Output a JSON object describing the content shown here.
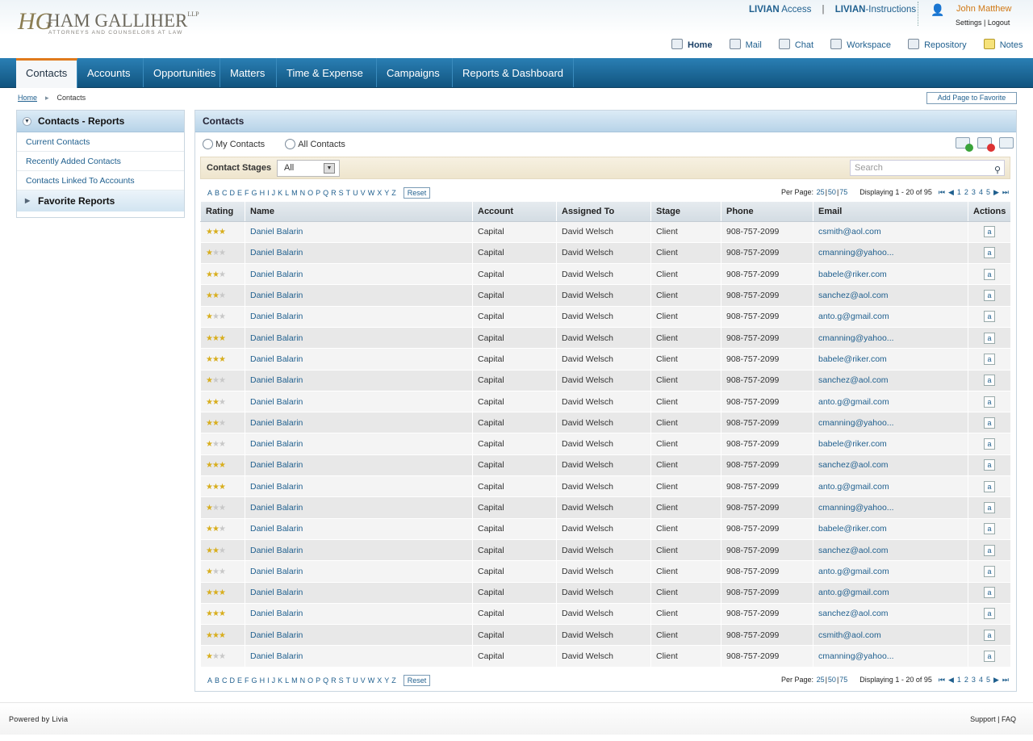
{
  "brand": {
    "monogram": "HG",
    "firm": "HAM GALLIHER",
    "llp": "LLP",
    "tagline": "ATTORNEYS AND COUNSELORS AT LAW"
  },
  "toplinks": {
    "livian": "LIVIAN",
    "access": "Access",
    "sep": "|",
    "instructions": "-Instructions"
  },
  "user": {
    "name": "John Matthew",
    "settings": "Settings",
    "sep": "|",
    "logout": "Logout"
  },
  "iconnav": [
    "Home",
    "Mail",
    "Chat",
    "Workspace",
    "Repository",
    "Notes"
  ],
  "tabs": [
    "Contacts",
    "Accounts",
    "Opportunities",
    "Matters",
    "Time & Expense",
    "Campaigns",
    "Reports & Dashboard"
  ],
  "crumbs": {
    "home": "Home",
    "current": "Contacts"
  },
  "fav_button": "Add Page to Favorite",
  "side": {
    "title": "Contacts - Reports",
    "items": [
      "Current Contacts",
      "Recently Added Contacts",
      "Contacts Linked To Accounts"
    ],
    "favorites": "Favorite Reports"
  },
  "panel": {
    "title": "Contacts",
    "radio_my": "My Contacts",
    "radio_all": "All Contacts",
    "stage_label": "Contact Stages",
    "stage_value": "All",
    "search_placeholder": "Search"
  },
  "pager": {
    "letters": [
      "A",
      "B",
      "C",
      "D",
      "E",
      "F",
      "G",
      "H",
      "I",
      "J",
      "K",
      "L",
      "M",
      "N",
      "O",
      "P",
      "Q",
      "R",
      "S",
      "T",
      "U",
      "V",
      "W",
      "X",
      "Y",
      "Z"
    ],
    "reset": "Reset",
    "per_page_label": "Per Page:",
    "per_25": "25",
    "per_50": "50",
    "per_75": "75",
    "displaying": "Displaying 1 - 20 of 95",
    "pages": [
      "1",
      "2",
      "3",
      "4",
      "5"
    ]
  },
  "columns": [
    "Rating",
    "Name",
    "Account",
    "Assigned To",
    "Stage",
    "Phone",
    "Email",
    "Actions"
  ],
  "rows": [
    {
      "rating": 3,
      "name": "Daniel Balarin",
      "account": "Capital",
      "assigned": "David Welsch",
      "stage": "Client",
      "phone": "908-757-2099",
      "email": "csmith@aol.com"
    },
    {
      "rating": 1,
      "name": "Daniel Balarin",
      "account": "Capital",
      "assigned": "David Welsch",
      "stage": "Client",
      "phone": "908-757-2099",
      "email": "cmanning@yahoo..."
    },
    {
      "rating": 2,
      "name": "Daniel Balarin",
      "account": "Capital",
      "assigned": "David Welsch",
      "stage": "Client",
      "phone": "908-757-2099",
      "email": "babele@riker.com"
    },
    {
      "rating": 2,
      "name": "Daniel Balarin",
      "account": "Capital",
      "assigned": "David Welsch",
      "stage": "Client",
      "phone": "908-757-2099",
      "email": "sanchez@aol.com"
    },
    {
      "rating": 1,
      "name": "Daniel Balarin",
      "account": "Capital",
      "assigned": "David Welsch",
      "stage": "Client",
      "phone": "908-757-2099",
      "email": "anto.g@gmail.com"
    },
    {
      "rating": 3,
      "name": "Daniel Balarin",
      "account": "Capital",
      "assigned": "David Welsch",
      "stage": "Client",
      "phone": "908-757-2099",
      "email": "cmanning@yahoo..."
    },
    {
      "rating": 3,
      "name": "Daniel Balarin",
      "account": "Capital",
      "assigned": "David Welsch",
      "stage": "Client",
      "phone": "908-757-2099",
      "email": "babele@riker.com"
    },
    {
      "rating": 1,
      "name": "Daniel Balarin",
      "account": "Capital",
      "assigned": "David Welsch",
      "stage": "Client",
      "phone": "908-757-2099",
      "email": "sanchez@aol.com"
    },
    {
      "rating": 2,
      "name": "Daniel Balarin",
      "account": "Capital",
      "assigned": "David Welsch",
      "stage": "Client",
      "phone": "908-757-2099",
      "email": "anto.g@gmail.com"
    },
    {
      "rating": 2,
      "name": "Daniel Balarin",
      "account": "Capital",
      "assigned": "David Welsch",
      "stage": "Client",
      "phone": "908-757-2099",
      "email": "cmanning@yahoo..."
    },
    {
      "rating": 1,
      "name": "Daniel Balarin",
      "account": "Capital",
      "assigned": "David Welsch",
      "stage": "Client",
      "phone": "908-757-2099",
      "email": "babele@riker.com"
    },
    {
      "rating": 3,
      "name": "Daniel Balarin",
      "account": "Capital",
      "assigned": "David Welsch",
      "stage": "Client",
      "phone": "908-757-2099",
      "email": "sanchez@aol.com"
    },
    {
      "rating": 3,
      "name": "Daniel Balarin",
      "account": "Capital",
      "assigned": "David Welsch",
      "stage": "Client",
      "phone": "908-757-2099",
      "email": "anto.g@gmail.com"
    },
    {
      "rating": 1,
      "name": "Daniel Balarin",
      "account": "Capital",
      "assigned": "David Welsch",
      "stage": "Client",
      "phone": "908-757-2099",
      "email": "cmanning@yahoo..."
    },
    {
      "rating": 2,
      "name": "Daniel Balarin",
      "account": "Capital",
      "assigned": "David Welsch",
      "stage": "Client",
      "phone": "908-757-2099",
      "email": "babele@riker.com"
    },
    {
      "rating": 2,
      "name": "Daniel Balarin",
      "account": "Capital",
      "assigned": "David Welsch",
      "stage": "Client",
      "phone": "908-757-2099",
      "email": "sanchez@aol.com"
    },
    {
      "rating": 1,
      "name": "Daniel Balarin",
      "account": "Capital",
      "assigned": "David Welsch",
      "stage": "Client",
      "phone": "908-757-2099",
      "email": "anto.g@gmail.com"
    },
    {
      "rating": 3,
      "name": "Daniel Balarin",
      "account": "Capital",
      "assigned": "David Welsch",
      "stage": "Client",
      "phone": "908-757-2099",
      "email": "anto.g@gmail.com"
    },
    {
      "rating": 3,
      "name": "Daniel Balarin",
      "account": "Capital",
      "assigned": "David Welsch",
      "stage": "Client",
      "phone": "908-757-2099",
      "email": "sanchez@aol.com"
    },
    {
      "rating": 3,
      "name": "Daniel Balarin",
      "account": "Capital",
      "assigned": "David Welsch",
      "stage": "Client",
      "phone": "908-757-2099",
      "email": "csmith@aol.com"
    },
    {
      "rating": 1,
      "name": "Daniel Balarin",
      "account": "Capital",
      "assigned": "David Welsch",
      "stage": "Client",
      "phone": "908-757-2099",
      "email": "cmanning@yahoo..."
    }
  ],
  "row_action": "a",
  "footer": {
    "powered": "Powered by Livia",
    "support": "Support",
    "sep": "|",
    "faq": "FAQ"
  }
}
